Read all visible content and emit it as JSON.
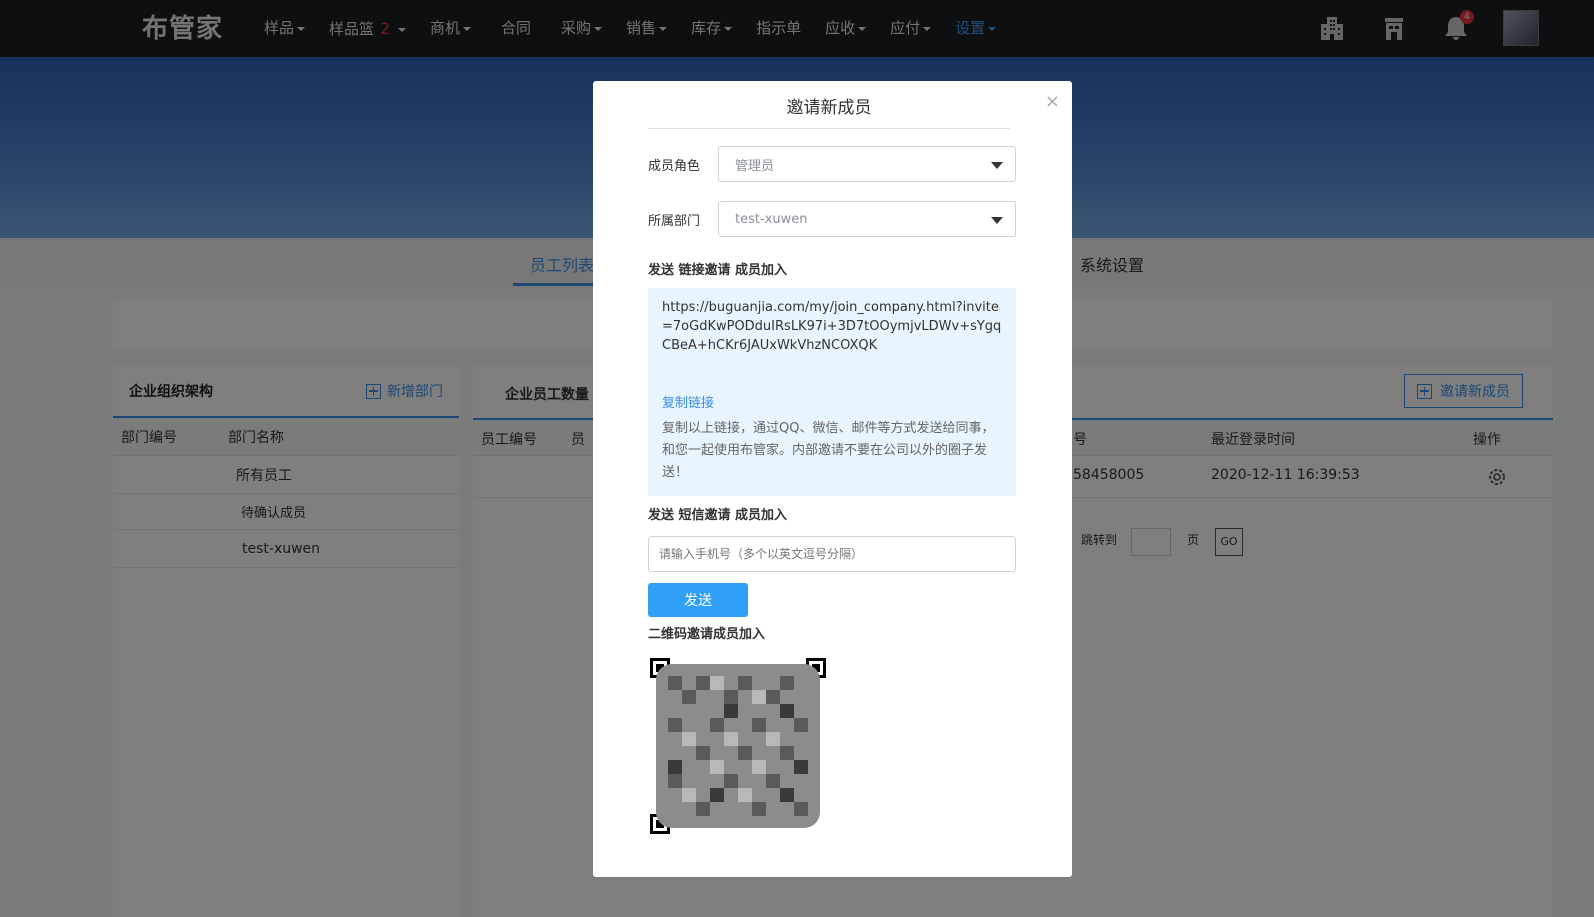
{
  "nav": {
    "logo": "布管家",
    "menu": [
      {
        "label": "样品",
        "caret": true
      },
      {
        "label": "样品篮",
        "badge": "2",
        "caret": true
      },
      {
        "label": "商机",
        "caret": true
      },
      {
        "label": "合同",
        "caret": false
      },
      {
        "label": "采购",
        "caret": true
      },
      {
        "label": "销售",
        "caret": true
      },
      {
        "label": "库存",
        "caret": true
      },
      {
        "label": "指示单",
        "caret": false
      },
      {
        "label": "应收",
        "caret": true
      },
      {
        "label": "应付",
        "caret": true
      },
      {
        "label": "设置",
        "caret": true
      }
    ],
    "notification_count": "4",
    "icons": [
      "building-icon",
      "store-icon",
      "bell-icon"
    ]
  },
  "tabs": {
    "employees": "员工列表",
    "system": "系统设置"
  },
  "left_panel": {
    "title": "企业组织架构",
    "add_dept": "新增部门",
    "col_code": "部门编号",
    "col_name": "部门名称",
    "rows": [
      "所有员工",
      "待确认成员",
      "test-xuwen"
    ]
  },
  "right_panel": {
    "title": "企业员工数量",
    "invite_button": "邀请新成员",
    "columns": [
      "员工编号",
      "员",
      "号",
      "最近登录时间",
      "操作"
    ],
    "row": {
      "phone_tail": "58458005",
      "last_login": "2020-12-11 16:39:53"
    },
    "pager": {
      "goto": "跳转到",
      "page": "页",
      "go": "GO"
    }
  },
  "modal": {
    "title": "邀请新成员",
    "close": "×",
    "role_label": "成员角色",
    "role_value": "管理员",
    "dept_label": "所属部门",
    "dept_value": "test-xuwen",
    "link_section": "发送 链接邀请 成员加入",
    "link_url": "https://buguanjia.com/my/join_company.html?invite=7oGdKwPODduIRsLK97i+3D7tOOymjvLDWv+sYgqCBeA+hCKr6JAUxWkVhzNCOXQK",
    "copy_link": "复制链接",
    "link_desc": "复制以上链接，通过QQ、微信、邮件等方式发送给同事，和您一起使用布管家。内部邀请不要在公司以外的圈子发送！",
    "sms_section": "发送 短信邀请 成员加入",
    "phone_placeholder": "请输入手机号（多个以英文逗号分隔）",
    "send": "发送",
    "qr_section": "二维码邀请成员加入"
  }
}
